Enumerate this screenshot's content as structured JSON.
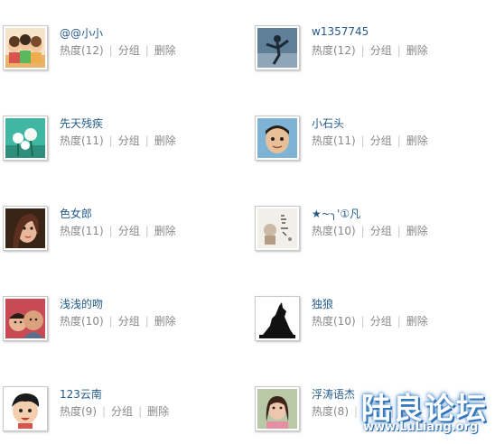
{
  "friends": [
    {
      "name": "@@小小",
      "heat": "热度(12)",
      "group": "分组",
      "remove": "删除",
      "avatar": "cartoon-kids-avatar"
    },
    {
      "name": "w1357745",
      "heat": "热度(12)",
      "group": "分组",
      "remove": "删除",
      "avatar": "dancer-photo-avatar"
    },
    {
      "name": "先天残疾",
      "heat": "热度(11)",
      "group": "分组",
      "remove": "删除",
      "avatar": "flowers-avatar"
    },
    {
      "name": "小石头",
      "heat": "热度(11)",
      "group": "分组",
      "remove": "删除",
      "avatar": "boy-photo-avatar"
    },
    {
      "name": "色女郎",
      "heat": "热度(11)",
      "group": "分组",
      "remove": "删除",
      "avatar": "woman-photo-avatar"
    },
    {
      "name": "★~╮'①凡",
      "heat": "热度(10)",
      "group": "分组",
      "remove": "删除",
      "avatar": "sketch-avatar"
    },
    {
      "name": "浅浅的吻",
      "heat": "热度(10)",
      "group": "分组",
      "remove": "删除",
      "avatar": "family-photo-avatar"
    },
    {
      "name": "独狼",
      "heat": "热度(10)",
      "group": "分组",
      "remove": "删除",
      "avatar": "wolf-silhouette-avatar"
    },
    {
      "name": "123云南",
      "heat": "热度(9)",
      "group": "分组",
      "remove": "删除",
      "avatar": "cartoon-boy-avatar"
    },
    {
      "name": "浮涛语杰",
      "heat": "热度(8)",
      "group": "分组",
      "remove": "删除",
      "avatar": "girl-photo-avatar"
    }
  ],
  "watermark": {
    "title": "陆良论坛",
    "url": "www.LuLiang.org"
  },
  "colors": {
    "link": "#245a8a",
    "meta": "#888888",
    "separator": "#c7c7c7",
    "watermark": "#2b6cb0"
  }
}
